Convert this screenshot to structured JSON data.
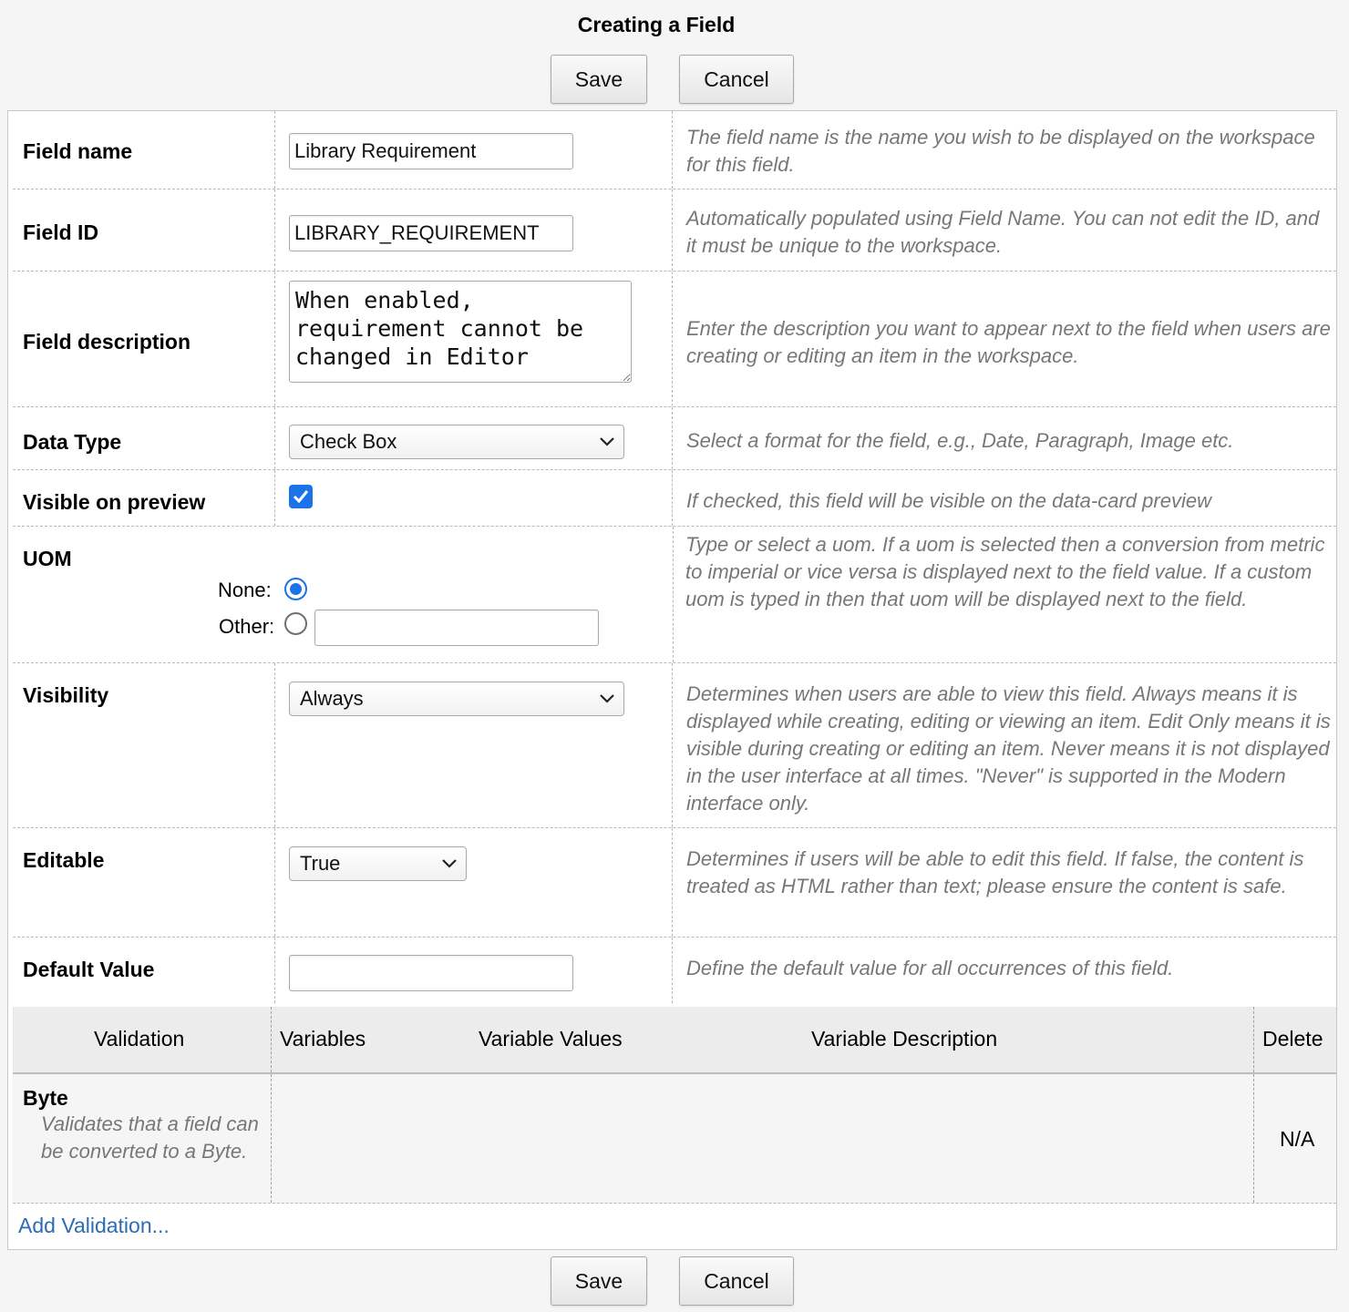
{
  "title": "Creating a Field",
  "buttons": {
    "save": "Save",
    "cancel": "Cancel"
  },
  "fields": {
    "field_name": {
      "label": "Field name",
      "value": "Library Requirement",
      "help": "The field name is the name you wish to be displayed on the workspace for this field."
    },
    "field_id": {
      "label": "Field ID",
      "value": "LIBRARY_REQUIREMENT",
      "help": "Automatically populated using Field Name. You can not edit the ID, and it must be unique to the workspace."
    },
    "field_description": {
      "label": "Field description",
      "value": "When enabled, requirement cannot be changed in Editor",
      "help": "Enter the description you want to appear next to the field when users are creating or editing an item in the workspace."
    },
    "data_type": {
      "label": "Data Type",
      "value": "Check Box",
      "help": "Select a format for the field, e.g., Date, Paragraph, Image etc."
    },
    "visible_on_preview": {
      "label": "Visible on preview",
      "checked": true,
      "help": "If checked, this field will be visible on the data-card preview"
    },
    "uom": {
      "label": "UOM",
      "none_label": "None:",
      "other_label": "Other:",
      "selected": "none",
      "other_value": "",
      "help": "Type or select a uom. If a uom is selected then a conversion from metric to imperial or vice versa is displayed next to the field value. If a custom uom is typed in then that uom will be displayed next to the field."
    },
    "visibility": {
      "label": "Visibility",
      "value": "Always",
      "help": "Determines when users are able to view this field. Always means it is displayed while creating, editing or viewing an item. Edit Only means it is visible during creating or editing an item. Never means it is not displayed in the user interface at all times. \"Never\" is supported in the Modern interface only."
    },
    "editable": {
      "label": "Editable",
      "value": "True",
      "help": "Determines if users will be able to edit this field. If false, the content is treated as HTML rather than text; please ensure the content is safe."
    },
    "default_value": {
      "label": "Default Value",
      "value": "",
      "help": "Define the default value for all occurrences of this field."
    }
  },
  "validation": {
    "headers": {
      "validation": "Validation",
      "variables": "Variables",
      "variable_values": "Variable Values",
      "variable_description": "Variable Description",
      "delete": "Delete"
    },
    "rows": [
      {
        "name": "Byte",
        "description": "Validates that a field can be converted to a Byte.",
        "delete": "N/A"
      }
    ],
    "add_link": "Add Validation..."
  },
  "icons": {
    "dropdown": "chevron-down-icon",
    "check": "checkmark-icon"
  },
  "colors": {
    "accent": "#1a73e8",
    "link": "#2b6db4",
    "help_text": "#777777"
  }
}
